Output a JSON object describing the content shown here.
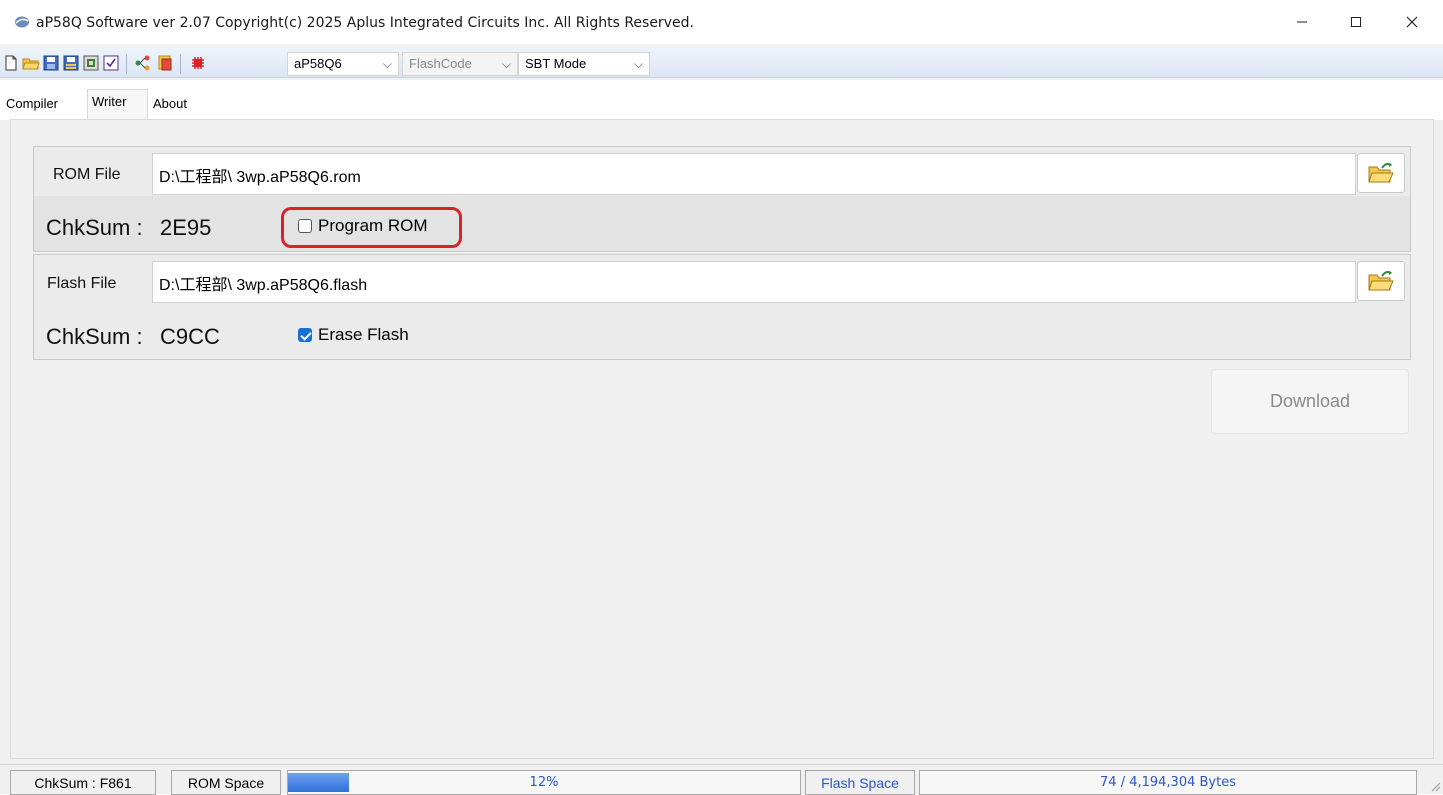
{
  "window": {
    "title": "aP58Q Software ver 2.07  Copyright(c) 2025 Aplus Integrated Circuits Inc. All Rights Reserved.",
    "icon": "app-logo-icon",
    "controls": [
      "minimize-icon",
      "maximize-icon",
      "close-icon"
    ]
  },
  "toolbar": {
    "icons": [
      "new-file-icon",
      "open-folder-icon",
      "save-icon",
      "save-as-icon",
      "compile-icon",
      "check-icon",
      "connect-icon",
      "export-icon",
      "chip-icon"
    ],
    "device": "aP58Q6",
    "code_type": "FlashCode",
    "mode": "SBT Mode"
  },
  "tabs": [
    {
      "label": "Compiler",
      "active": false
    },
    {
      "label": "Writer",
      "active": true
    },
    {
      "label": "About",
      "active": false
    }
  ],
  "writer": {
    "rom": {
      "label": "ROM File",
      "path": "D:\\工程部\\ 3wp.aP58Q6.rom",
      "chksum_label": "ChkSum :",
      "chksum_value": "2E95",
      "option_label": "Program ROM",
      "option_checked": false
    },
    "flash": {
      "label": "Flash File",
      "path": "D:\\工程部\\ 3wp.aP58Q6.flash",
      "chksum_label": "ChkSum :",
      "chksum_value": "C9CC",
      "option_label": "Erase Flash",
      "option_checked": true
    },
    "download_label": "Download",
    "download_enabled": false
  },
  "statusbar": {
    "chksum": "ChkSum : F861",
    "rom_space_label": "ROM Space",
    "rom_percent_text": "12%",
    "rom_fill_fraction": 0.12,
    "flash_space_label": "Flash Space",
    "flash_bytes": "74 / 4,194,304 Bytes"
  },
  "colors": {
    "highlight_annotation": "#d8232a",
    "checkbox_checked": "#1a6fd6",
    "progress_fill": "#2f6fd8",
    "status_text": "#2b55c8"
  }
}
